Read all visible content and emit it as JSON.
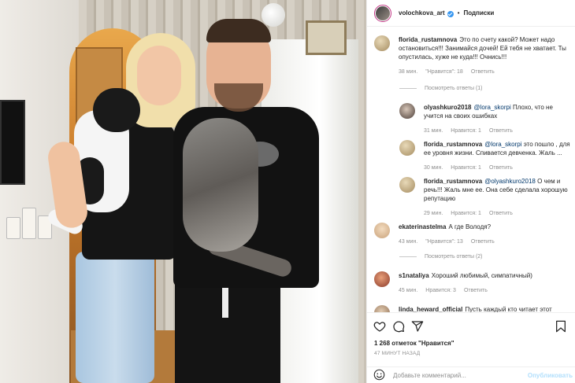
{
  "post": {
    "username": "volochkova_art",
    "follow_label": "Подписки",
    "likes": "1 268 отметок \"Нравится\"",
    "time": "47 МИНУТ НАЗАД",
    "comment_placeholder": "Добавьте комментарий...",
    "publish_label": "Опубликовать"
  },
  "comments": [
    {
      "username": "florida_rustamnova",
      "text": "Это по счету какой? Может надо остановиться!!! Занимайся дочей! Ей тебя не хватает. Ты опустилась, хуже не куда!!! Очнись!!!",
      "time": "38 мин.",
      "likes": "\"Нравится\": 18",
      "reply": "Ответить",
      "view_replies": "Посмотреть ответы (1)"
    },
    {
      "username": "olyashkuro2018",
      "mention": "@lora_skorpi",
      "text": " Плохо, что не учится на своих ошибках",
      "time": "31 мин.",
      "likes": "Нравится: 1",
      "reply": "Ответить"
    },
    {
      "username": "florida_rustamnova",
      "mention": "@lora_skorpi",
      "text": " это пошло , для ее уровня жизни. Спивается девченка. Жаль ...",
      "time": "30 мин.",
      "likes": "Нравится: 1",
      "reply": "Ответить"
    },
    {
      "username": "florida_rustamnova",
      "mention": "@olyashkuro2018",
      "text": " О чем и речь!!! Жаль мне ее. Она себе сделала хорошую репутацию",
      "time": "29 мин.",
      "likes": "Нравится: 1",
      "reply": "Ответить"
    },
    {
      "username": "ekaterinastelma",
      "text": "А где Володя?",
      "time": "43 мин.",
      "likes": "\"Нравится\": 13",
      "reply": "Ответить",
      "view_replies": "Посмотреть ответы (2)"
    },
    {
      "username": "s1nataliya",
      "text": "Хороший любимый, симпатичный)",
      "time": "45 мин.",
      "likes": "Нравится: 3",
      "reply": "Ответить"
    },
    {
      "username": "linda_heward_official",
      "text": "Пусть каждый кто читает этот"
    }
  ],
  "colors": {
    "accent": "#3897f0",
    "muted": "#8e8e8e",
    "mention": "#00376b",
    "publish": "#b2dffc"
  },
  "icons": [
    "heart-icon",
    "comment-icon",
    "share-icon",
    "bookmark-icon",
    "emoji-icon",
    "verified-icon"
  ]
}
